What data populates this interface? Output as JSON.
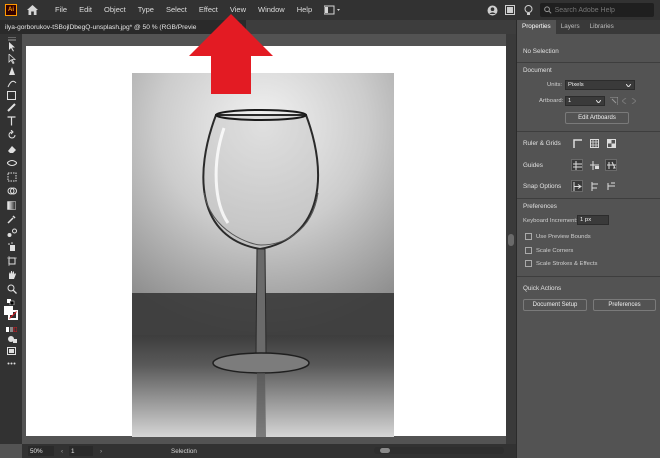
{
  "app": {
    "logo_text": "Ai",
    "menu": [
      "File",
      "Edit",
      "Object",
      "Type",
      "Select",
      "Effect",
      "View",
      "Window",
      "Help"
    ],
    "search_placeholder": "Search Adobe Help"
  },
  "document": {
    "tab_title": "ilya-gorborukov-tSBojlDbegQ-unsplash.jpg* @ 50 % (RGB/Previe",
    "close_label": "×"
  },
  "status": {
    "zoom": "50%",
    "prev_nav": "‹",
    "next_nav": "›",
    "artboard": "1",
    "mode": "Selection"
  },
  "panel": {
    "tabs": [
      "Properties",
      "Layers",
      "Libraries"
    ],
    "no_selection": "No Selection",
    "document_title": "Document",
    "units_label": "Units:",
    "units_value": "Pixels",
    "artboard_label": "Artboard:",
    "artboard_value": "1",
    "edit_artboards": "Edit Artboards",
    "ruler_grids": "Ruler & Grids",
    "guides": "Guides",
    "snap_options": "Snap Options",
    "preferences_title": "Preferences",
    "keyboard_increment_label": "Keyboard Increment:",
    "keyboard_increment_value": "1 px",
    "checkboxes": [
      "Use Preview Bounds",
      "Scale Corners",
      "Scale Strokes & Effects"
    ],
    "quick_actions": "Quick Actions",
    "document_setup": "Document Setup",
    "preferences_button": "Preferences"
  },
  "colors": {
    "accent_arrow": "#e31b23",
    "menubar": "#323232",
    "panel": "#535353"
  }
}
